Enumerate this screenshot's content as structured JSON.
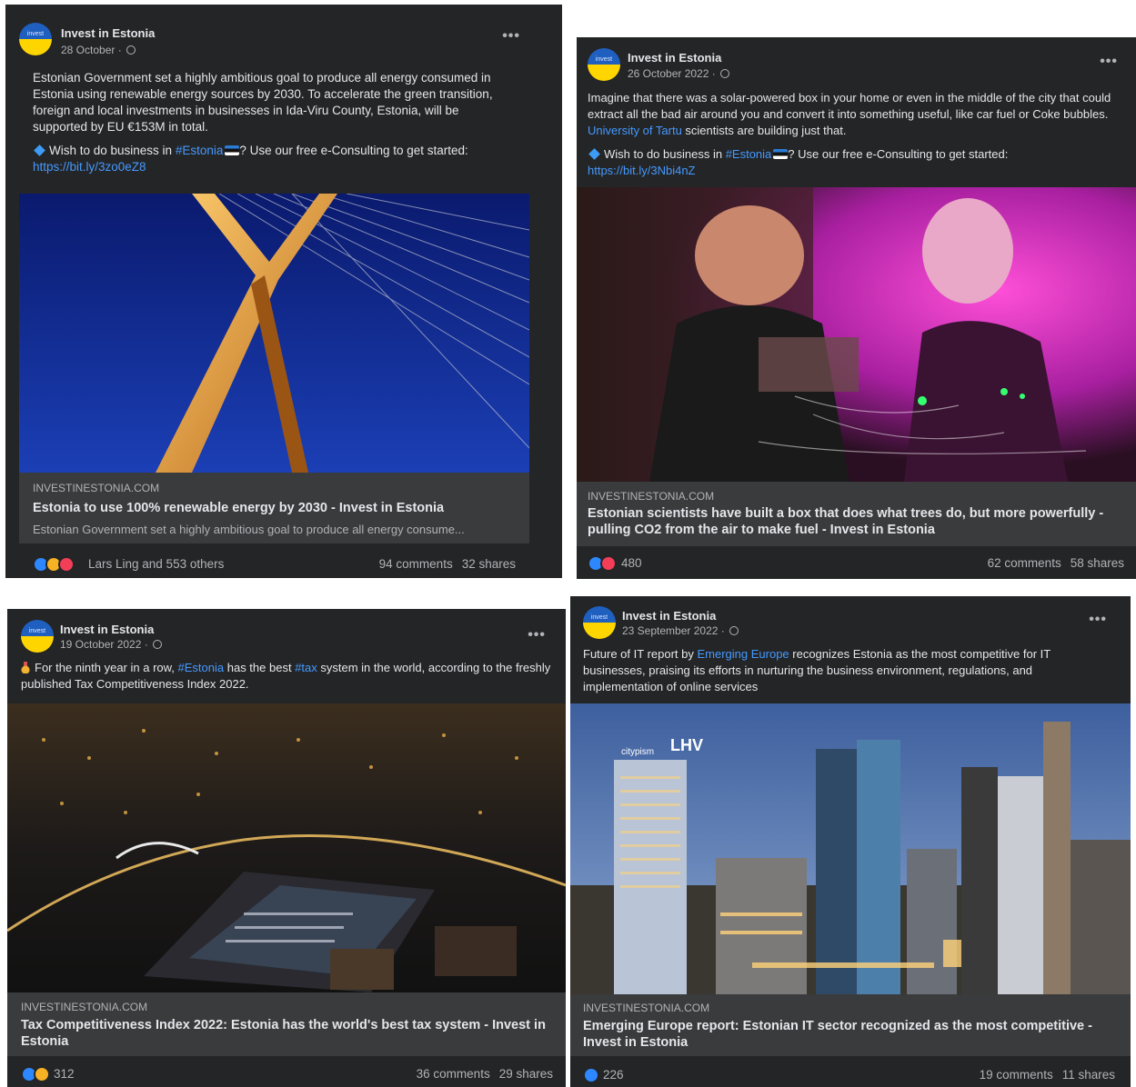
{
  "posts": [
    {
      "page_name": "Invest in Estonia",
      "date": "28 October ·",
      "avatar_text": "invest",
      "text_lines": [
        "Estonian Government set a highly ambitious goal to produce all energy consumed in Estonia using renewable energy sources by 2030. To accelerate the green transition, foreign and local investments in businesses in Ida-Viru County, Estonia, will be supported by EU €153M in total."
      ],
      "wish_prefix": "Wish to do business in ",
      "wish_tag": "#Estonia",
      "wish_suffix": "? Use our free e-Consulting to get started:",
      "link": "https://bit.ly/3zo0eZ8",
      "domain": "INVESTINESTONIA.COM",
      "title": "Estonia to use 100% renewable energy by 2030 - Invest in Estonia",
      "description": "Estonian Government set a highly ambitious goal to produce all energy consume...",
      "reactions_label": "Lars Ling and 553 others",
      "comments": "94 comments",
      "shares": "32 shares"
    },
    {
      "page_name": "Invest in Estonia",
      "date": "26 October 2022 ·",
      "avatar_text": "invest",
      "text_before_link": "Imagine that there was a solar-powered box in your home or even in the middle of the city that could extract all the bad air around you and convert it into something useful, like car fuel or Coke bubbles. ",
      "inline_link": "University of Tartu",
      "text_after_link": " scientists are building just that.",
      "wish_prefix": "Wish to do business in ",
      "wish_tag": "#Estonia",
      "wish_suffix": "? Use our free e-Consulting to get started:",
      "link": "https://bit.ly/3Nbi4nZ",
      "domain": "INVESTINESTONIA.COM",
      "title": "Estonian scientists have built a box that does what trees do, but more powerfully - pulling CO2 from the air to make fuel - Invest in Estonia",
      "reactions_label": "480",
      "comments": "62 comments",
      "shares": "58 shares"
    },
    {
      "page_name": "Invest in Estonia",
      "date": "19 October 2022 ·",
      "avatar_text": "invest",
      "text_a": "For the ninth year in a row, ",
      "tag_a": "#Estonia",
      "text_b": " has the best ",
      "tag_b": "#tax",
      "text_c": " system in the world, according to the freshly published Tax Competitiveness Index 2022.",
      "domain": "INVESTINESTONIA.COM",
      "title": "Tax Competitiveness Index 2022: Estonia has the world's best tax system - Invest in Estonia",
      "reactions_label": "312",
      "comments": "36 comments",
      "shares": "29 shares"
    },
    {
      "page_name": "Invest in Estonia",
      "date": "23 September 2022 ·",
      "avatar_text": "invest",
      "text_a": "Future of IT report by ",
      "inline_link": "Emerging Europe",
      "text_b": " recognizes Estonia as the most competitive for IT businesses, praising its efforts in nurturing the business environment, regulations, and implementation of online services",
      "sign_text": "LHV",
      "sign_text_2": "citypism",
      "domain": "INVESTINESTONIA.COM",
      "title": "Emerging Europe report: Estonian IT sector recognized as the most competitive - Invest in Estonia",
      "reactions_label": "226",
      "comments": "19 comments",
      "shares": "11 shares"
    }
  ],
  "colors": {
    "card_bg": "#242526",
    "caption_bg": "#3a3b3c",
    "link": "#4599ff",
    "text_primary": "#e4e6eb",
    "text_secondary": "#b0b3b8"
  },
  "icons": [
    "globe-icon",
    "more-icon",
    "diamond-icon",
    "estonia-flag-icon",
    "medal-icon",
    "like-icon",
    "haha-icon",
    "love-icon"
  ]
}
